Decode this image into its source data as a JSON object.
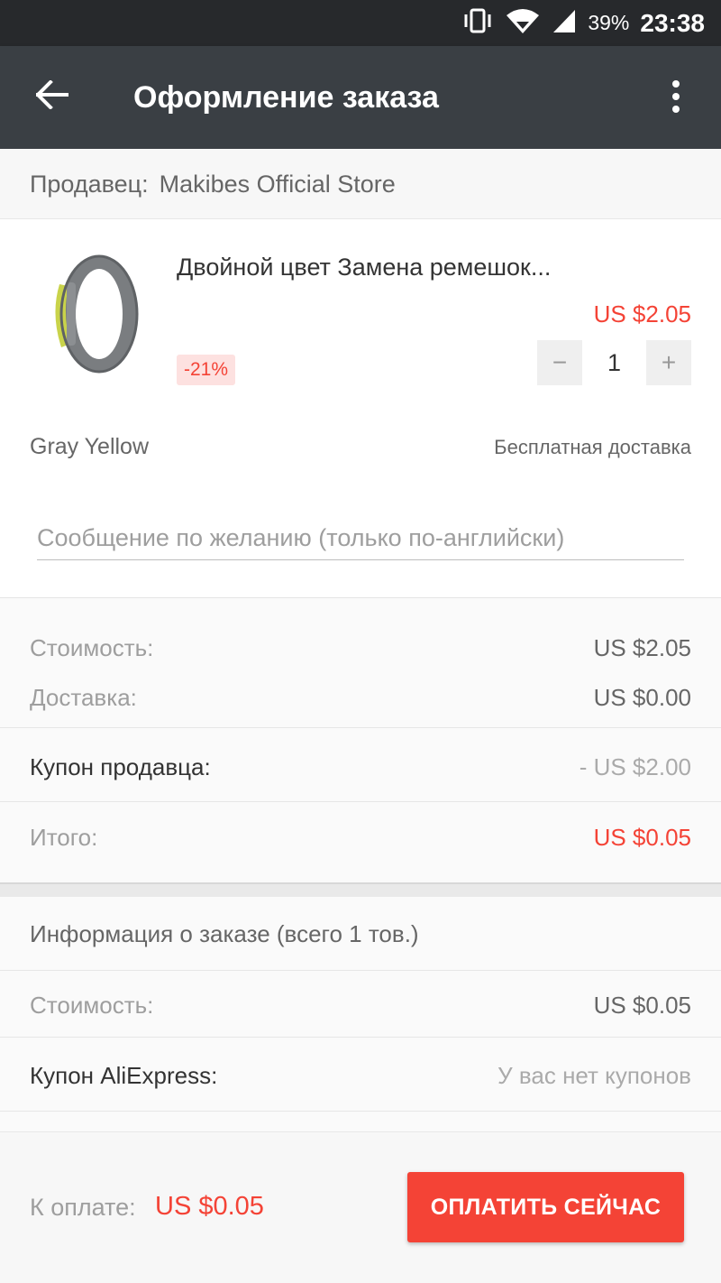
{
  "status_bar": {
    "battery_percent": "39%",
    "time": "23:38"
  },
  "app_bar": {
    "title": "Оформление заказа",
    "back_icon": "arrow-left-icon",
    "more_icon": "more-vertical-icon"
  },
  "seller": {
    "label": "Продавец:",
    "name": "Makibes Official Store"
  },
  "product": {
    "title": "Двойной цвет Замена ремешок...",
    "price": "US $2.05",
    "discount": "-21%",
    "quantity": "1",
    "minus": "−",
    "plus": "+",
    "variant": "Gray Yellow",
    "shipping": "Бесплатная доставка",
    "message_placeholder": "Сообщение по желанию (только по-английски)"
  },
  "summary": {
    "cost_label": "Стоимость:",
    "cost_value": "US $2.05",
    "delivery_label": "Доставка:",
    "delivery_value": "US $0.00",
    "seller_coupon_label": "Купон продавца:",
    "seller_coupon_value": "- US $2.00",
    "total_label": "Итого:",
    "total_value": "US $0.05"
  },
  "order_info": {
    "header": "Информация о заказе (всего 1 тов.)",
    "cost_label": "Стоимость:",
    "cost_value": "US $0.05",
    "ali_coupon_label": "Купон AliExpress:",
    "ali_coupon_value": "У вас нет купонов"
  },
  "bottom": {
    "pay_label": "К оплате:",
    "pay_amount": "US $0.05",
    "pay_button": "ОПЛАТИТЬ СЕЙЧАС"
  },
  "colors": {
    "accent_red": "#f44336",
    "app_bar": "#3a3f44",
    "status_bar": "#27292c"
  }
}
